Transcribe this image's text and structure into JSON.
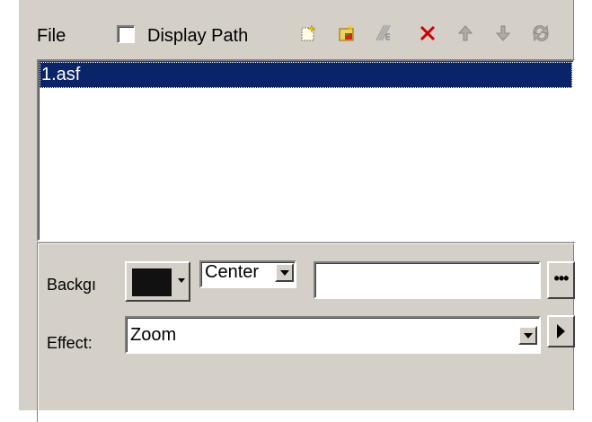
{
  "toolbar": {
    "file_label": "File",
    "display_path_label": "Display Path",
    "display_path_checked": false,
    "buttons": [
      {
        "icon": "new-file-icon"
      },
      {
        "icon": "open-folder-icon"
      },
      {
        "icon": "edit-icon"
      },
      {
        "icon": "delete-icon"
      },
      {
        "icon": "move-up-icon"
      },
      {
        "icon": "move-down-icon"
      },
      {
        "icon": "refresh-icon"
      }
    ]
  },
  "file_list": {
    "items": [
      "1.asf"
    ],
    "selected_index": 0
  },
  "settings": {
    "background_label": "Backgı",
    "background_color": "#111111",
    "alignment_value": "Center",
    "path_value": "",
    "browse_label": "•••",
    "effect_label": "Effect:",
    "effect_value": "Zoom"
  },
  "colors": {
    "face": "#d4d0c8",
    "selection": "#0a246a",
    "delete_red": "#cc0000"
  }
}
